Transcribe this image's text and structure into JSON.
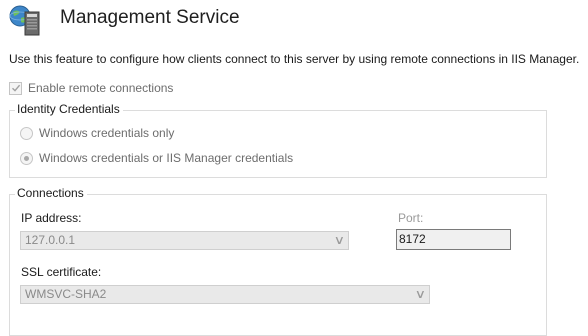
{
  "header": {
    "icon": "iis-management-service-icon",
    "title": "Management Service"
  },
  "description": "Use this feature to configure how clients connect to this server by using remote connections in IIS Manager.",
  "enable_remote": {
    "label": "Enable remote connections",
    "checked": true,
    "disabled": true
  },
  "identity": {
    "title": "Identity Credentials",
    "options": [
      {
        "label": "Windows credentials only",
        "selected": false
      },
      {
        "label": "Windows credentials or IIS Manager credentials",
        "selected": true
      }
    ]
  },
  "connections": {
    "title": "Connections",
    "ip_label": "IP address:",
    "ip_value": "127.0.0.1",
    "port_label": "Port:",
    "port_value": "8172",
    "ssl_label": "SSL certificate:",
    "ssl_value": "WMSVC-SHA2"
  },
  "colors": {
    "disabled_text": "#6d6d6d",
    "group_border": "#dcdcdc",
    "disabled_field_bg": "#e9e9e9"
  }
}
